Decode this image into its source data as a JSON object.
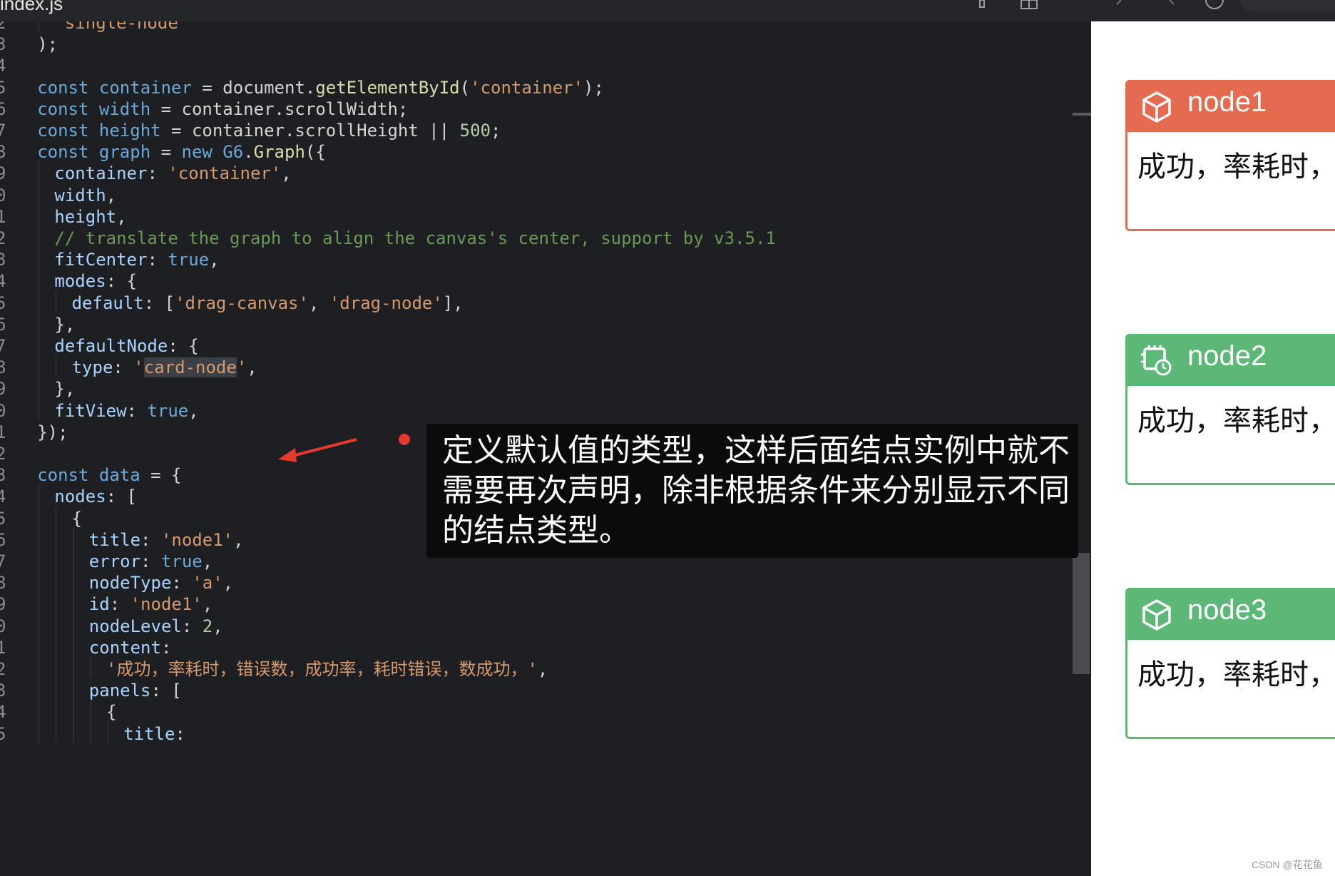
{
  "tab": {
    "label": "index.js"
  },
  "lines": [
    {
      "num": "2",
      "indent": 2,
      "tokens": [
        [
          "str",
          "'single-node'"
        ]
      ]
    },
    {
      "num": "3",
      "indent": 1,
      "tokens": [
        [
          "pun",
          ");"
        ]
      ]
    },
    {
      "num": "4",
      "indent": 0,
      "tokens": []
    },
    {
      "num": "5",
      "indent": 1,
      "tokens": [
        [
          "kw",
          "const "
        ],
        [
          "var",
          "container"
        ],
        [
          "pun",
          " = "
        ],
        [
          "pun",
          "document."
        ],
        [
          "fn",
          "getElementById"
        ],
        [
          "pun",
          "("
        ],
        [
          "str",
          "'container'"
        ],
        [
          "pun",
          ");"
        ]
      ]
    },
    {
      "num": "6",
      "indent": 1,
      "tokens": [
        [
          "kw",
          "const "
        ],
        [
          "var",
          "width"
        ],
        [
          "pun",
          " = container.scrollWidth;"
        ]
      ]
    },
    {
      "num": "7",
      "indent": 1,
      "tokens": [
        [
          "kw",
          "const "
        ],
        [
          "var",
          "height"
        ],
        [
          "pun",
          " = container.scrollHeight || "
        ],
        [
          "num",
          "500"
        ],
        [
          "pun",
          ";"
        ]
      ]
    },
    {
      "num": "8",
      "indent": 1,
      "tokens": [
        [
          "kw",
          "const "
        ],
        [
          "var",
          "graph"
        ],
        [
          "pun",
          " = "
        ],
        [
          "kw",
          "new "
        ],
        [
          "var",
          "G6"
        ],
        [
          "pun",
          "."
        ],
        [
          "fn",
          "Graph"
        ],
        [
          "pun",
          "({"
        ]
      ]
    },
    {
      "num": "9",
      "indent": 2,
      "tokens": [
        [
          "prop",
          "container"
        ],
        [
          "pun",
          ": "
        ],
        [
          "str",
          "'container'"
        ],
        [
          "pun",
          ","
        ]
      ]
    },
    {
      "num": "0",
      "indent": 2,
      "tokens": [
        [
          "prop",
          "width"
        ],
        [
          "pun",
          ","
        ]
      ]
    },
    {
      "num": "1",
      "indent": 2,
      "tokens": [
        [
          "prop",
          "height"
        ],
        [
          "pun",
          ","
        ]
      ]
    },
    {
      "num": "2",
      "indent": 2,
      "tokens": [
        [
          "cmt",
          "// translate the graph to align the canvas's center, support by v3.5.1"
        ]
      ]
    },
    {
      "num": "3",
      "indent": 2,
      "tokens": [
        [
          "prop",
          "fitCenter"
        ],
        [
          "pun",
          ": "
        ],
        [
          "bool",
          "true"
        ],
        [
          "pun",
          ","
        ]
      ]
    },
    {
      "num": "4",
      "indent": 2,
      "tokens": [
        [
          "prop",
          "modes"
        ],
        [
          "pun",
          ": {"
        ]
      ]
    },
    {
      "num": "5",
      "indent": 3,
      "tokens": [
        [
          "prop",
          "default"
        ],
        [
          "pun",
          ": ["
        ],
        [
          "str",
          "'drag-canvas'"
        ],
        [
          "pun",
          ", "
        ],
        [
          "str",
          "'drag-node'"
        ],
        [
          "pun",
          "],"
        ]
      ]
    },
    {
      "num": "6",
      "indent": 2,
      "tokens": [
        [
          "pun",
          "},"
        ]
      ]
    },
    {
      "num": "7",
      "indent": 2,
      "tokens": [
        [
          "prop",
          "defaultNode"
        ],
        [
          "pun",
          ": {"
        ]
      ]
    },
    {
      "num": "8",
      "indent": 3,
      "tokens": [
        [
          "prop",
          "type"
        ],
        [
          "pun",
          ": "
        ],
        [
          "str",
          "'"
        ],
        [
          "strhl",
          "card-node"
        ],
        [
          "str",
          "'"
        ],
        [
          "pun",
          ","
        ]
      ]
    },
    {
      "num": "9",
      "indent": 2,
      "tokens": [
        [
          "pun",
          "},"
        ]
      ]
    },
    {
      "num": "0",
      "indent": 2,
      "tokens": [
        [
          "prop",
          "fitView"
        ],
        [
          "pun",
          ": "
        ],
        [
          "bool",
          "true"
        ],
        [
          "pun",
          ","
        ]
      ]
    },
    {
      "num": "1",
      "indent": 1,
      "tokens": [
        [
          "pun",
          "});"
        ]
      ]
    },
    {
      "num": "2",
      "indent": 0,
      "tokens": []
    },
    {
      "num": "3",
      "indent": 1,
      "tokens": [
        [
          "kw",
          "const "
        ],
        [
          "var",
          "data"
        ],
        [
          "pun",
          " = {"
        ]
      ]
    },
    {
      "num": "4",
      "indent": 2,
      "tokens": [
        [
          "prop",
          "nodes"
        ],
        [
          "pun",
          ": ["
        ]
      ]
    },
    {
      "num": "5",
      "indent": 3,
      "tokens": [
        [
          "pun",
          "{"
        ]
      ]
    },
    {
      "num": "6",
      "indent": 4,
      "tokens": [
        [
          "prop",
          "title"
        ],
        [
          "pun",
          ": "
        ],
        [
          "str",
          "'node1'"
        ],
        [
          "pun",
          ","
        ]
      ]
    },
    {
      "num": "7",
      "indent": 4,
      "tokens": [
        [
          "prop",
          "error"
        ],
        [
          "pun",
          ": "
        ],
        [
          "bool",
          "true"
        ],
        [
          "pun",
          ","
        ]
      ]
    },
    {
      "num": "8",
      "indent": 4,
      "tokens": [
        [
          "prop",
          "nodeType"
        ],
        [
          "pun",
          ": "
        ],
        [
          "str",
          "'a'"
        ],
        [
          "pun",
          ","
        ]
      ]
    },
    {
      "num": "9",
      "indent": 4,
      "tokens": [
        [
          "prop",
          "id"
        ],
        [
          "pun",
          ": "
        ],
        [
          "str",
          "'node1'"
        ],
        [
          "pun",
          ","
        ]
      ]
    },
    {
      "num": "0",
      "indent": 4,
      "tokens": [
        [
          "prop",
          "nodeLevel"
        ],
        [
          "pun",
          ": "
        ],
        [
          "num",
          "2"
        ],
        [
          "pun",
          ","
        ]
      ]
    },
    {
      "num": "1",
      "indent": 4,
      "tokens": [
        [
          "prop",
          "content"
        ],
        [
          "pun",
          ":"
        ]
      ]
    },
    {
      "num": "2",
      "indent": 5,
      "tokens": [
        [
          "str",
          "'成功，率耗时，错误数，成功率，耗时错误，数成功，'"
        ],
        [
          "pun",
          ","
        ]
      ]
    },
    {
      "num": "3",
      "indent": 4,
      "tokens": [
        [
          "prop",
          "panels"
        ],
        [
          "pun",
          ": ["
        ]
      ]
    },
    {
      "num": "4",
      "indent": 5,
      "tokens": [
        [
          "pun",
          "{"
        ]
      ]
    },
    {
      "num": "5",
      "indent": 6,
      "tokens": [
        [
          "prop",
          "title"
        ],
        [
          "pun",
          ":"
        ]
      ]
    }
  ],
  "annotation": {
    "text": "定义默认值的类型，这样后面结点实例中就不需要再次声明，除非根据条件来分别显示不同的结点类型。"
  },
  "cards": [
    {
      "title": "node1",
      "color": "#e46b50",
      "icon": "cube-icon",
      "body": "成功，率耗时，"
    },
    {
      "title": "node2",
      "color": "#5cb877",
      "icon": "chip-clock-icon",
      "body": "成功，率耗时，"
    },
    {
      "title": "node3",
      "color": "#5cb877",
      "icon": "cube-icon",
      "body": "成功，率耗时，"
    }
  ],
  "watermark": "CSDN @花花鱼"
}
